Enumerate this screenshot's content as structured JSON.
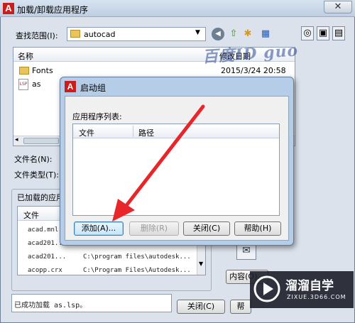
{
  "main_window": {
    "title": "加载/卸载应用程序",
    "close_symbol": "✕",
    "look_in_label": "查找范围(I):",
    "look_in_value": "autocad",
    "files_header_name": "名称",
    "files_header_date": "修改日期",
    "files": [
      {
        "name": "Fonts",
        "date": "2015/3/24 20:58",
        "icon": "folder-icon"
      },
      {
        "name": "as",
        "date": "",
        "icon": "lsp-file-icon"
      }
    ],
    "filename_label": "文件名(N):",
    "filetype_label": "文件类型(T):",
    "loaded_group_label": "已加载的应用",
    "loaded_header_file": "文件",
    "loaded_items": [
      {
        "file": "acad.mnl",
        "path": ""
      },
      {
        "file": "acad201...",
        "path": ""
      },
      {
        "file": "acad201...",
        "path": "C:\\program files\\autodesk..."
      },
      {
        "file": "acopp.crx",
        "path": "C:\\Program Files\\Autodesk..."
      }
    ],
    "contents_button": "内容(O)...",
    "status_text": "已成功加载 as.lsp。",
    "close_button": "关闭(C)",
    "help_button_partial": "帮"
  },
  "startup_dialog": {
    "title": "启动组",
    "list_label": "应用程序列表:",
    "header_file": "文件",
    "header_path": "路径",
    "add_button": "添加(A)...",
    "remove_button": "删除(R)",
    "close_button": "关闭(C)",
    "help_button": "帮助(H)"
  },
  "watermark_top": "百度ID guo",
  "brand": {
    "name": "溜溜自学",
    "url": "ZIXUE.3D66.COM",
    "color": "#1b6fd1"
  },
  "colors": {
    "arrow": "#e8262a",
    "acad_red": "#c81e1e"
  }
}
